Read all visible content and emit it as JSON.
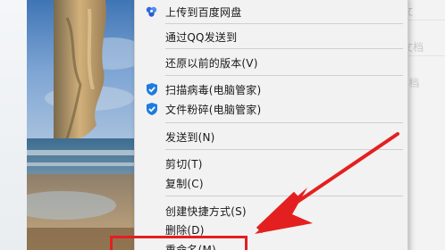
{
  "right_window": {
    "ghost_texts": [
      "rd 文",
      "rd 文档",
      "d 文档"
    ]
  },
  "menu": {
    "items": [
      {
        "label": "上传到百度网盘",
        "icon": "baidu-netdisk-icon"
      },
      {
        "label": "通过QQ发送到",
        "icon": ""
      },
      {
        "label": "还原以前的版本(V)",
        "icon": ""
      },
      {
        "label": "扫描病毒(电脑管家)",
        "icon": "tencent-pc-manager-shield-icon"
      },
      {
        "label": "文件粉碎(电脑管家)",
        "icon": "tencent-pc-manager-shield-icon"
      },
      {
        "label": "发送到(N)",
        "icon": ""
      },
      {
        "label": "剪切(T)",
        "icon": ""
      },
      {
        "label": "复制(C)",
        "icon": ""
      },
      {
        "label": "创建快捷方式(S)",
        "icon": ""
      },
      {
        "label": "删除(D)",
        "icon": ""
      },
      {
        "label": "重命名(M)",
        "icon": ""
      }
    ]
  },
  "colors": {
    "highlight": "#e41f1f",
    "menu_bg": "#f2f2f2",
    "shield_blue": "#1e7be0"
  }
}
